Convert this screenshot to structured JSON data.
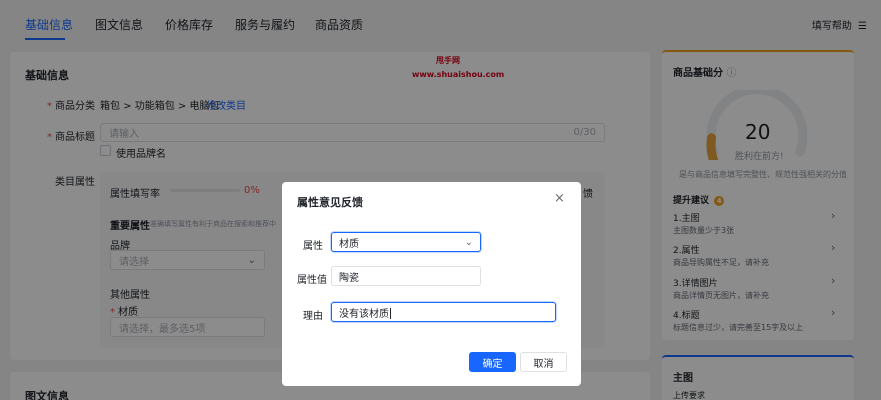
{
  "tabs": [
    {
      "label": "基础信息",
      "active": true
    },
    {
      "label": "图文信息"
    },
    {
      "label": "价格库存"
    },
    {
      "label": "服务与履约"
    },
    {
      "label": "商品资质"
    }
  ],
  "help_label": "填写帮助",
  "basic": {
    "section_title": "基础信息",
    "category_label": "商品分类",
    "category_value": "箱包 > 功能箱包 > 电脑包",
    "category_edit": "修改类目",
    "title_label": "商品标题",
    "title_placeholder": "请输入",
    "title_count": "0/30",
    "brand_checkbox_label": "使用品牌名",
    "attr_label": "类目属性",
    "fill_rate_label": "属性填写率",
    "fill_rate_value": "0%",
    "fill_rate_fraction": 0,
    "feedback_tail": "馈",
    "important_attrs_label": "重要属性",
    "important_attrs_hint": "准确填写属性有利于商品在搜索和推荐中",
    "brand_label": "品牌",
    "brand_placeholder": "请选择",
    "other_attrs_label": "其他属性",
    "material_label": "材质",
    "material_placeholder": "请选择，最多选5项"
  },
  "section2_title": "图文信息",
  "watermark": {
    "line1": "甩手网",
    "line2": "www.shuaishou.com"
  },
  "score": {
    "title": "商品基础分",
    "value": "20",
    "subtitle": "胜利在前方!",
    "desc": "是与商品信息填写完整性、规范性强相关的分值",
    "gauge_fraction": 0.2,
    "accent": "#e6a23c"
  },
  "suggestions": {
    "title": "提升建议",
    "count": "4",
    "items": [
      {
        "title": "1.主图",
        "desc": "主图数量少于3张"
      },
      {
        "title": "2.属性",
        "desc": "商品导购属性不足，请补充"
      },
      {
        "title": "3.详情图片",
        "desc": "商品详情页无图片，请补充"
      },
      {
        "title": "4.标题",
        "desc": "标题信息过少，请完善至15字及以上"
      }
    ]
  },
  "main_image": {
    "title": "主图",
    "subtitle": "上传要求"
  },
  "modal": {
    "title": "属性意见反馈",
    "attr_label": "属性",
    "attr_value": "材质",
    "attr_value_label": "属性值",
    "attr_value_value": "陶瓷",
    "reason_label": "理由",
    "reason_value": "没有该材质",
    "confirm": "确定",
    "cancel": "取消"
  },
  "colors": {
    "primary": "#1966ff",
    "required": "#f54a45",
    "score_top": "#f0a020",
    "card_top": "#1966ff"
  }
}
